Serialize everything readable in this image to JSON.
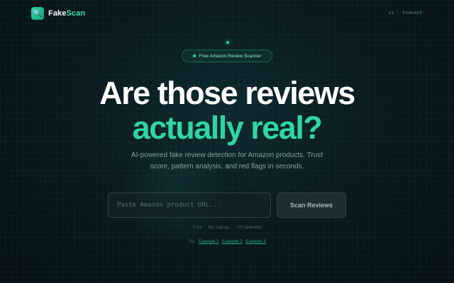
{
  "header": {
    "brand_prefix": "Fake",
    "brand_accent": "Scan",
    "tagline": "AI · POWERED"
  },
  "badge": {
    "label": "Free Amazon Review Scanner"
  },
  "hero": {
    "line1": "Are those reviews",
    "line2": "actually real?",
    "sub_line1": "AI-powered fake review detection for Amazon products. Trust",
    "sub_line2": "score, pattern analysis, and red flags in seconds."
  },
  "search": {
    "placeholder": "Paste Amazon product URL...",
    "value": "",
    "button_label": "Scan Reviews"
  },
  "meta": {
    "items": [
      "Free",
      "No signup",
      "~10 seconds"
    ],
    "separator": "·"
  },
  "examples": {
    "label": "Try:",
    "links": [
      "Example 1",
      "Example 2",
      "Example 3"
    ]
  },
  "colors": {
    "accent": "#2fd6a3",
    "background": "#0a1a20",
    "headline": "#ffffff"
  },
  "icons": {
    "logo": "search-icon"
  }
}
